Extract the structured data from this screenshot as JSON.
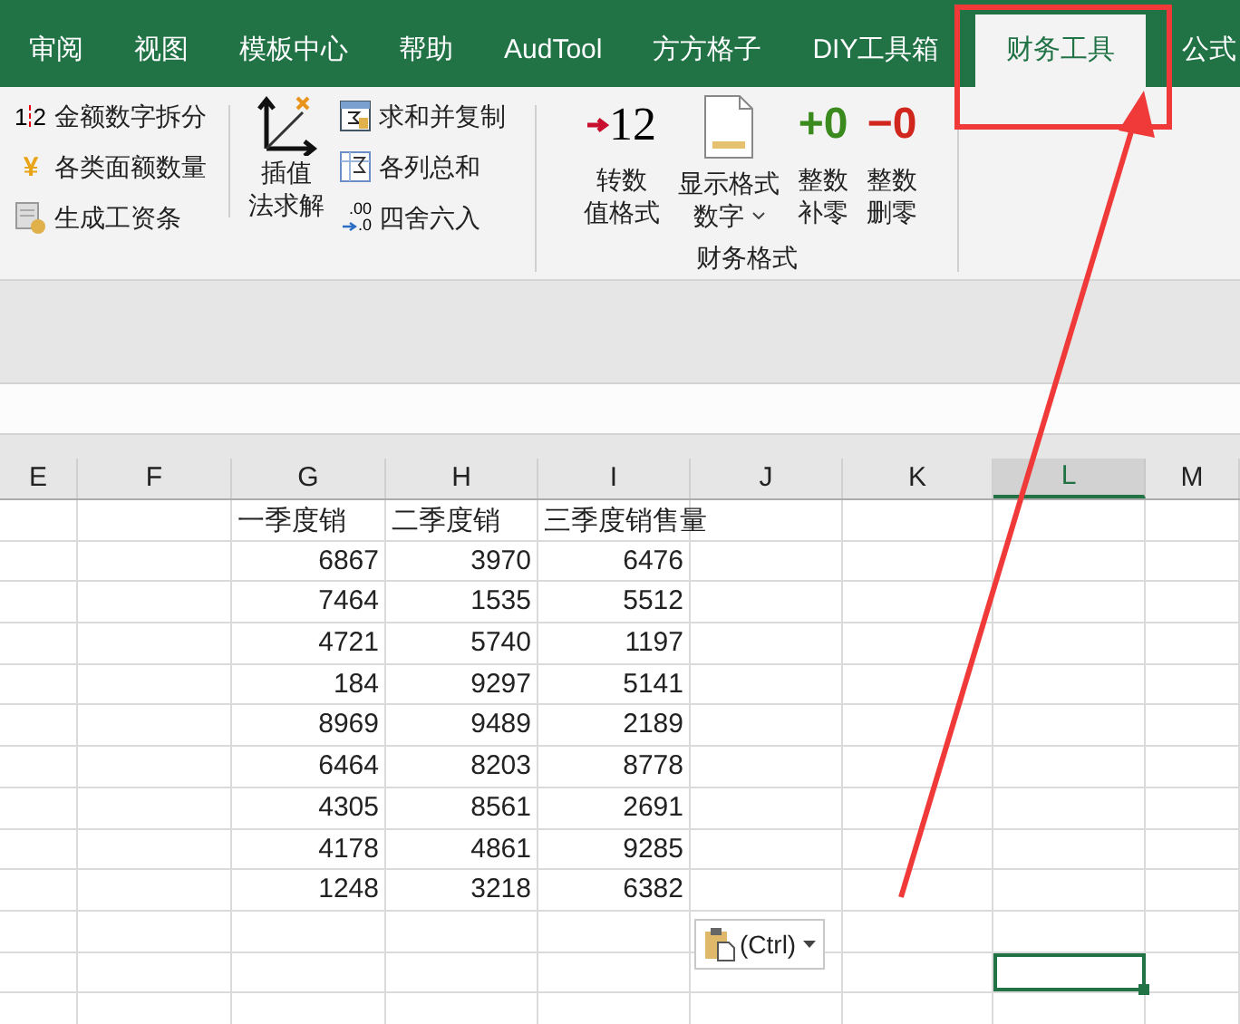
{
  "tabs": [
    {
      "label": "审阅",
      "selected": false
    },
    {
      "label": "视图",
      "selected": false
    },
    {
      "label": "模板中心",
      "selected": false
    },
    {
      "label": "帮助",
      "selected": false
    },
    {
      "label": "AudTool",
      "selected": false
    },
    {
      "label": "方方格子",
      "selected": false
    },
    {
      "label": "DIY工具箱",
      "selected": false
    },
    {
      "label": "财务工具",
      "selected": true
    },
    {
      "label": "公式",
      "selected": false
    }
  ],
  "ribbon": {
    "left_group": [
      {
        "kind": "split",
        "icon_text": [
          "1",
          "2"
        ],
        "label": "金额数字拆分"
      },
      {
        "kind": "yen",
        "icon_text": [
          "¥"
        ],
        "label": "各类面额数量"
      },
      {
        "kind": "payslip",
        "label": "生成工资条"
      }
    ],
    "solve_button": {
      "lines": [
        "插值",
        "法求解"
      ]
    },
    "middle_group": [
      {
        "kind": "sum-copy",
        "label": "求和并复制"
      },
      {
        "kind": "sum",
        "label": "各列总和"
      },
      {
        "kind": "round",
        "icon_text": [
          ".00",
          ".0"
        ],
        "label": "四舍六入"
      }
    ],
    "finance_group": {
      "label": "财务格式",
      "buttons": [
        {
          "kind": "convert",
          "icon_text": "12",
          "lines": [
            "转数",
            "值格式"
          ],
          "dropdown": false
        },
        {
          "kind": "doc",
          "lines": [
            "显示格式",
            "数字"
          ],
          "dropdown": true
        },
        {
          "kind": "plus",
          "icon_text": "+0",
          "lines": [
            "整数",
            "补零"
          ],
          "dropdown": false
        },
        {
          "kind": "minus",
          "icon_text": "−0",
          "lines": [
            "整数",
            "删零"
          ],
          "dropdown": false
        }
      ]
    }
  },
  "sheet": {
    "columns": [
      {
        "letter": "E",
        "selected": false
      },
      {
        "letter": "F",
        "selected": false
      },
      {
        "letter": "G",
        "selected": false
      },
      {
        "letter": "H",
        "selected": false
      },
      {
        "letter": "I",
        "selected": false
      },
      {
        "letter": "J",
        "selected": false
      },
      {
        "letter": "K",
        "selected": false
      },
      {
        "letter": "L",
        "selected": true
      },
      {
        "letter": "M",
        "selected": false
      }
    ],
    "header_row": [
      "一季度销",
      "二季度销",
      "三季度销售量"
    ],
    "rows": [
      {
        "cells": [
          "6867",
          "3970",
          "6476"
        ],
        "selected": false
      },
      {
        "cells": [
          "7464",
          "1535",
          "5512"
        ],
        "selected": false
      },
      {
        "cells": [
          "4721",
          "5740",
          "1197"
        ],
        "selected": false
      },
      {
        "cells": [
          "184",
          "9297",
          "5141"
        ],
        "selected": false
      },
      {
        "cells": [
          "8969",
          "9489",
          "2189"
        ],
        "selected": false
      },
      {
        "cells": [
          "6464",
          "8203",
          "8778"
        ],
        "selected": false
      },
      {
        "cells": [
          "4305",
          "8561",
          "2691"
        ],
        "selected": false
      },
      {
        "cells": [
          "4178",
          "4861",
          "9285"
        ],
        "selected": false
      },
      {
        "cells": [
          "1248",
          "3218",
          "6382"
        ],
        "selected": false
      },
      {
        "selected": false
      },
      {
        "selected": true
      },
      {
        "selected": false
      }
    ],
    "paste_options": {
      "label": "(Ctrl)"
    }
  }
}
